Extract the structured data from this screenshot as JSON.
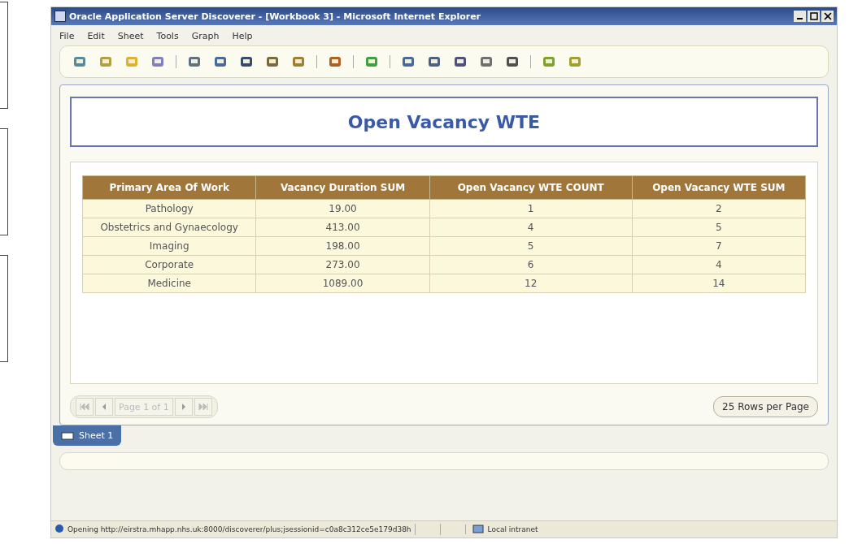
{
  "window": {
    "title": "Oracle Application Server Discoverer - [Workbook 3] - Microsoft Internet Explorer"
  },
  "menu": [
    "File",
    "Edit",
    "Sheet",
    "Tools",
    "Graph",
    "Help"
  ],
  "report": {
    "title": "Open Vacancy WTE"
  },
  "table": {
    "columns": [
      "Primary Area Of Work",
      "Vacancy Duration SUM",
      "Open Vacancy WTE COUNT",
      "Open Vacancy WTE SUM"
    ],
    "rows": [
      [
        "Pathology",
        "19.00",
        "1",
        "2"
      ],
      [
        "Obstetrics and Gynaecology",
        "413.00",
        "4",
        "5"
      ],
      [
        "Imaging",
        "198.00",
        "5",
        "7"
      ],
      [
        "Corporate",
        "273.00",
        "6",
        "4"
      ],
      [
        "Medicine",
        "1089.00",
        "12",
        "14"
      ]
    ]
  },
  "pager": {
    "page_label": "Page 1 of 1",
    "rows_per_page": "25 Rows per Page"
  },
  "sheet_tabs": [
    {
      "label": "Sheet 1",
      "selected": true
    }
  ],
  "status_bar": {
    "message": "Opening http://eirstra.mhapp.nhs.uk:8000/discoverer/plus;jsessionid=c0a8c312ce5e179d38h",
    "zone": "Local intranet"
  }
}
